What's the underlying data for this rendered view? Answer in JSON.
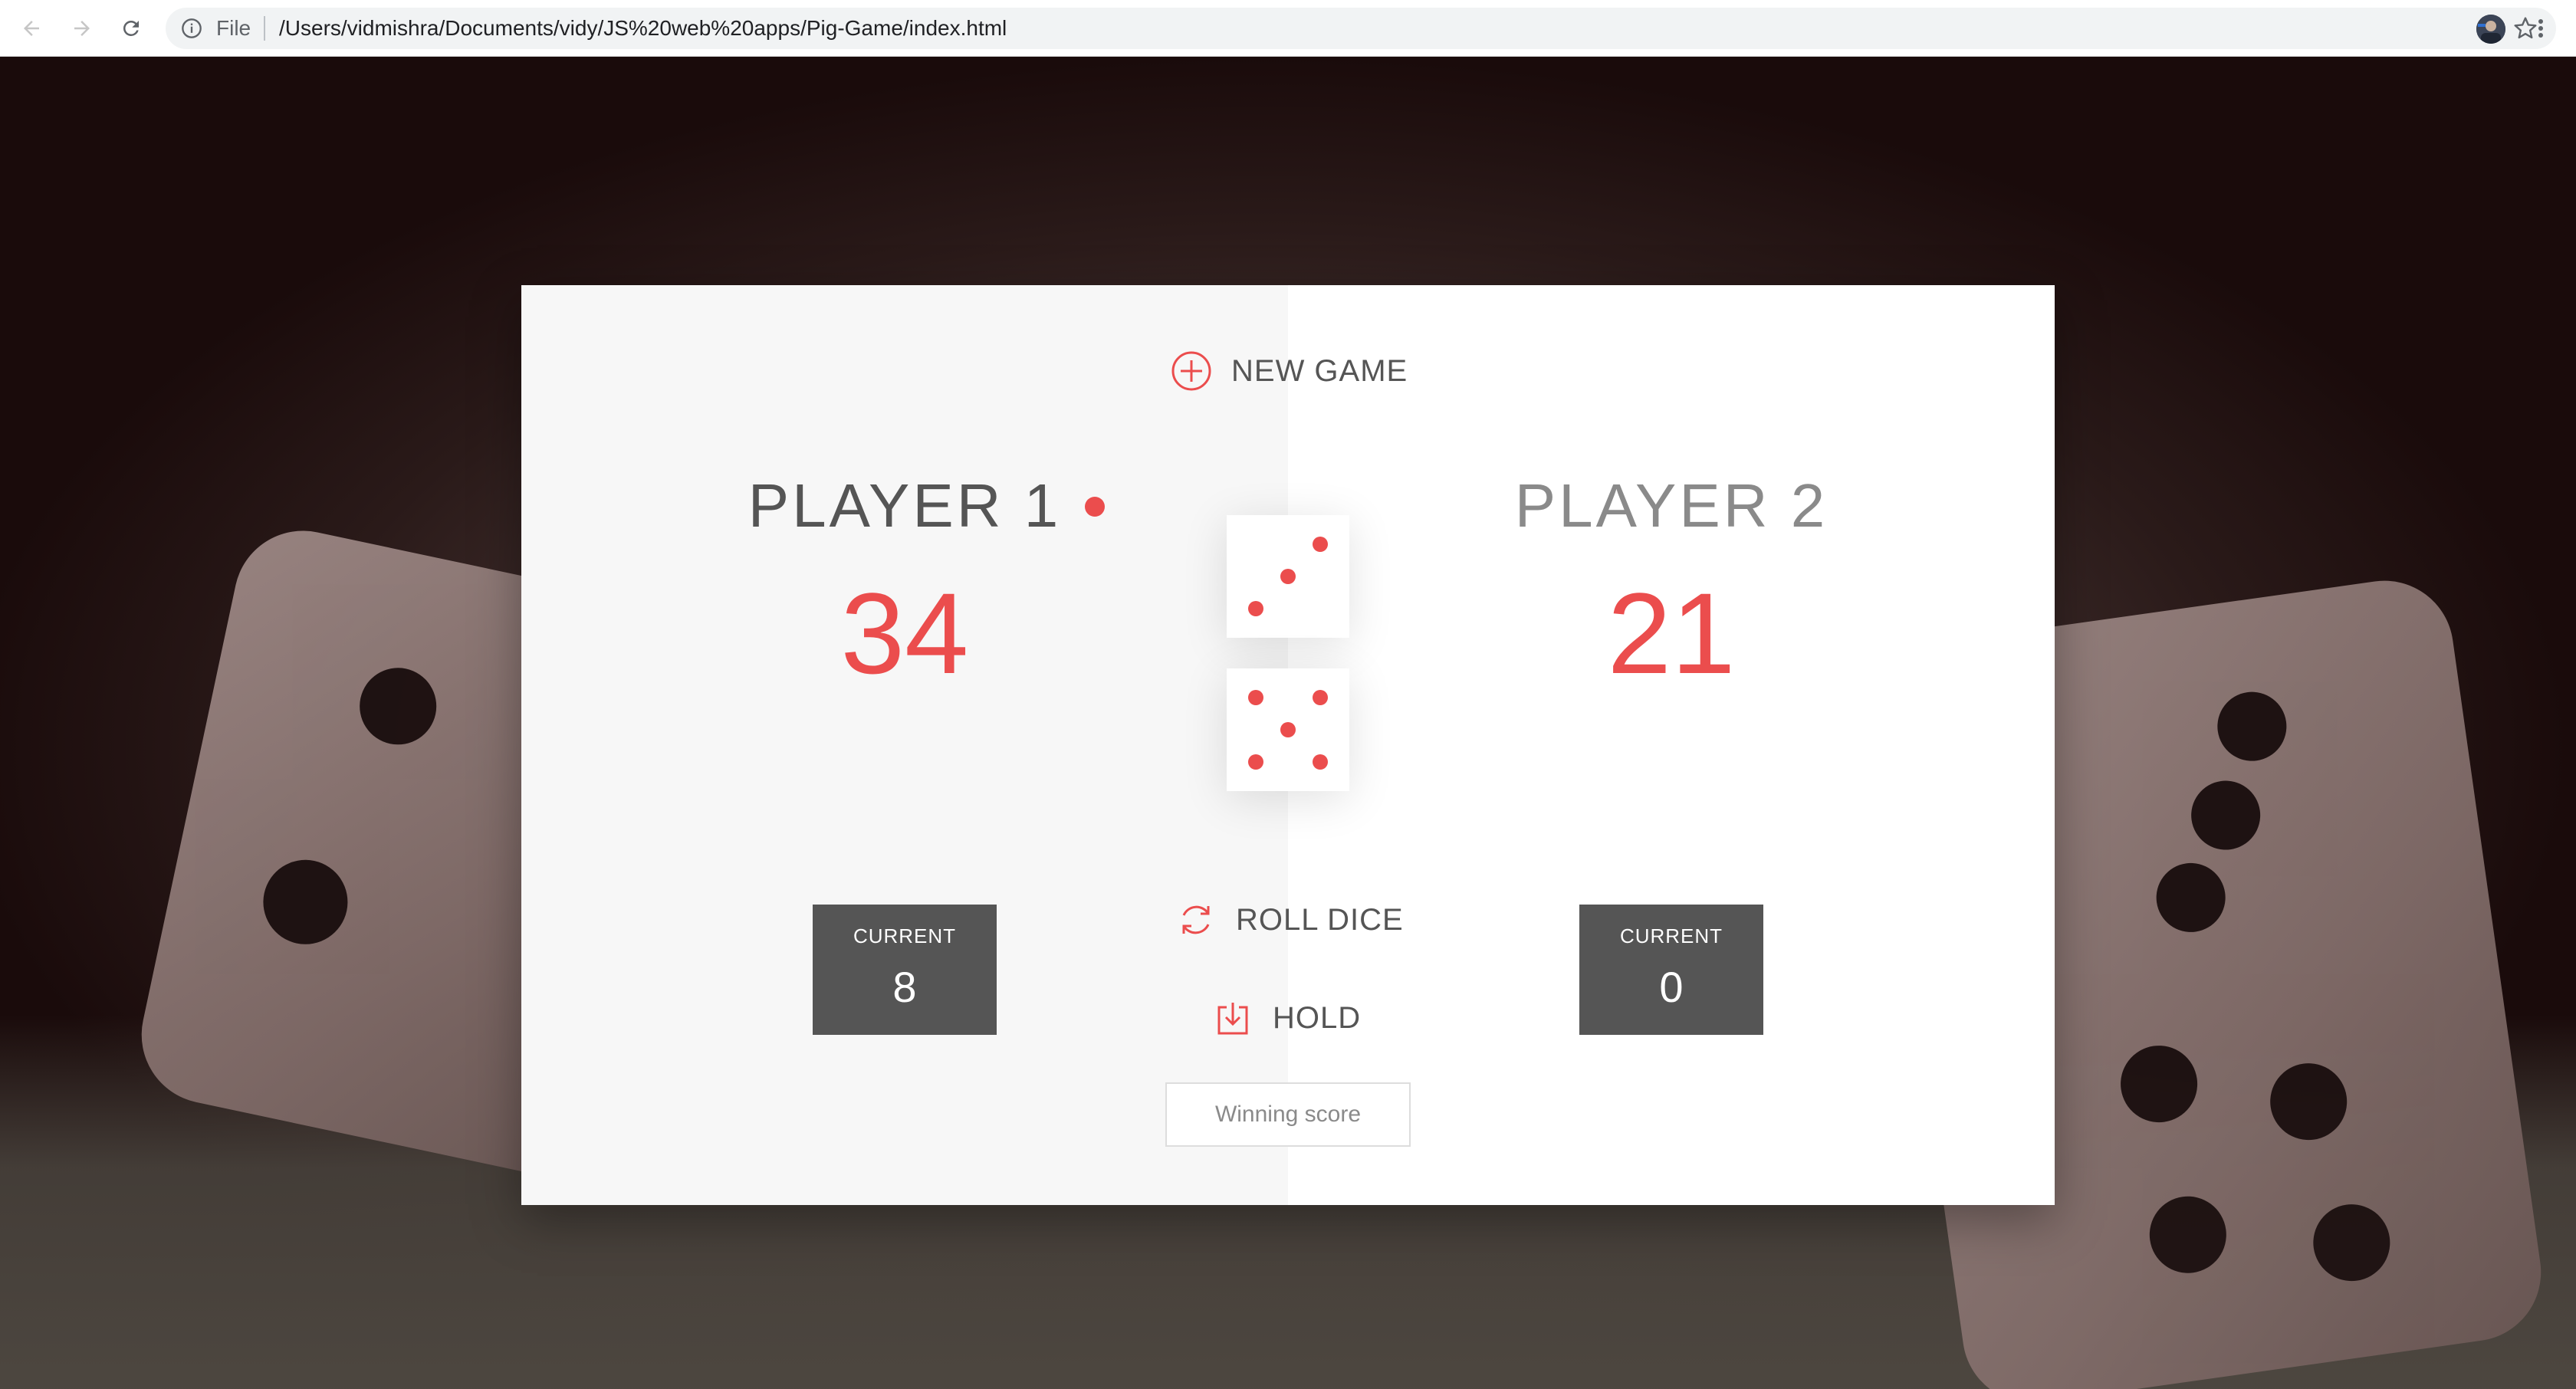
{
  "browser": {
    "scheme_label": "File",
    "url": "/Users/vidmishra/Documents/vidy/JS%20web%20apps/Pig-Game/index.html"
  },
  "game": {
    "new_game_label": "NEW GAME",
    "roll_dice_label": "ROLL DICE",
    "hold_label": "HOLD",
    "winning_score_placeholder": "Winning score",
    "active_player": 1,
    "dice_values": [
      3,
      5
    ],
    "players": [
      {
        "name": "PLAYER 1",
        "score": "34",
        "current_label": "CURRENT",
        "current": "8"
      },
      {
        "name": "PLAYER 2",
        "score": "21",
        "current_label": "CURRENT",
        "current": "0"
      }
    ]
  },
  "colors": {
    "accent": "#eb4d4d",
    "text": "#555555",
    "panel_left": "#f7f7f7",
    "panel_right": "#ffffff",
    "current_box": "#555555"
  }
}
